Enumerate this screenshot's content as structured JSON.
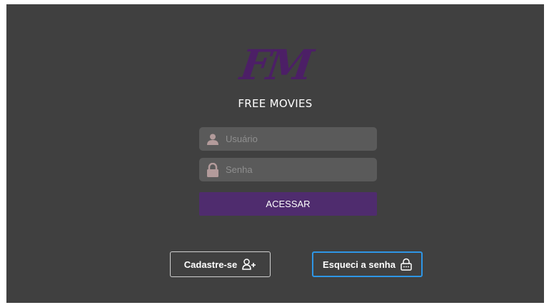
{
  "logo": {
    "mark": "FM",
    "name": "FREE MOVIES"
  },
  "login": {
    "username_placeholder": "Usuário",
    "password_placeholder": "Senha",
    "submit_label": "ACESSAR"
  },
  "actions": {
    "signup_label": "Cadastre-se",
    "forgot_label": "Esqueci a senha"
  },
  "colors": {
    "background": "#404040",
    "accent": "#4f2c6e",
    "focus": "#2e96e6"
  },
  "icons": {
    "user": "user-icon",
    "lock": "lock-icon",
    "add_user": "add-user-icon",
    "forgot_lock": "lock-outline-icon"
  }
}
